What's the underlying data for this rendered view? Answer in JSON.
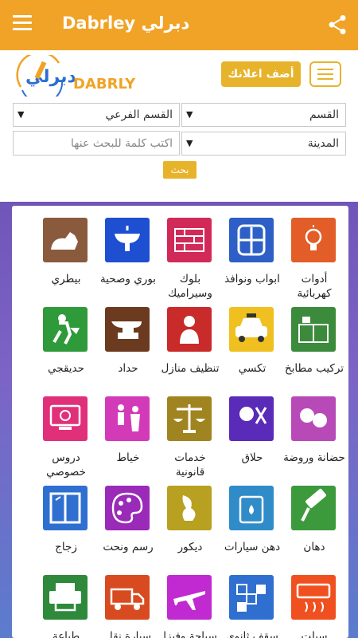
{
  "app_bar": {
    "title": "Dabrley دبرلي",
    "menu_icon": "hamburger-icon",
    "share_icon": "share-icon"
  },
  "header": {
    "logo_text": "DABRLY",
    "add_ad_label": "أضف اعلانك",
    "menu_icon": "hamburger-icon"
  },
  "filters": {
    "category": "القسم",
    "subcategory": "القسم الفرعي",
    "city": "المدينة",
    "search_placeholder": "اكتب كلمة للبحث عنها",
    "search_button": "بحث"
  },
  "colors": {
    "app_bar": "#f0a326",
    "accent": "#e6b32a",
    "background_gradient_top": "#6f56b8",
    "background_gradient_bottom": "#5b7ccc"
  },
  "categories": [
    {
      "label": "أدوات كهربائية",
      "icon": "light-bulb-icon",
      "color": "#e35d28"
    },
    {
      "label": "ابواب ونوافذ",
      "icon": "window-icon",
      "color": "#2d5fc6"
    },
    {
      "label": "بلوك وسيراميك",
      "icon": "brick-wall-icon",
      "color": "#d12a59"
    },
    {
      "label": "بوري وصحية",
      "icon": "sink-icon",
      "color": "#1e4fd0"
    },
    {
      "label": "بيطري",
      "icon": "dog-cat-icon",
      "color": "#8a5a3c"
    },
    {
      "label": "تركيب مطابخ",
      "icon": "kitchen-icon",
      "color": "#3c8a3c"
    },
    {
      "label": "تكسي",
      "icon": "taxi-icon",
      "color": "#f0c020"
    },
    {
      "label": "تنظيف منازل",
      "icon": "maid-icon",
      "color": "#c92a2a"
    },
    {
      "label": "حداد",
      "icon": "anvil-icon",
      "color": "#6b3a1f"
    },
    {
      "label": "حديقجي",
      "icon": "gardener-icon",
      "color": "#2e9a3a"
    },
    {
      "label": "حضانة وروضة",
      "icon": "kids-icon",
      "color": "#b84ab8"
    },
    {
      "label": "حلاق",
      "icon": "barber-icon",
      "color": "#5a2ab8"
    },
    {
      "label": "خدمات قانونية",
      "icon": "scales-icon",
      "color": "#a08420"
    },
    {
      "label": "خياط",
      "icon": "tailor-icon",
      "color": "#d23ab8"
    },
    {
      "label": "دروس خصوصي",
      "icon": "online-lesson-icon",
      "color": "#e0307a"
    },
    {
      "label": "دهان",
      "icon": "paint-roller-icon",
      "color": "#3c9a3c"
    },
    {
      "label": "دهن سيارات",
      "icon": "paint-can-icon",
      "color": "#2f8cc8"
    },
    {
      "label": "ديكور",
      "icon": "vase-icon",
      "color": "#b8a020"
    },
    {
      "label": "رسم ونحت",
      "icon": "palette-icon",
      "color": "#9a2ab8"
    },
    {
      "label": "زجاج",
      "icon": "glass-window-icon",
      "color": "#2f6fd0"
    },
    {
      "label": "سبلت",
      "icon": "air-conditioner-icon",
      "color": "#f05020"
    },
    {
      "label": "سقف ثانوي",
      "icon": "ceiling-icon",
      "color": "#2f6fd0"
    },
    {
      "label": "سياحة وفيزا",
      "icon": "airplane-icon",
      "color": "#c02ad0"
    },
    {
      "label": "سيارة نقل",
      "icon": "truck-icon",
      "color": "#d84a1f"
    },
    {
      "label": "طباعة",
      "icon": "printer-icon",
      "color": "#2e8a3a"
    }
  ]
}
